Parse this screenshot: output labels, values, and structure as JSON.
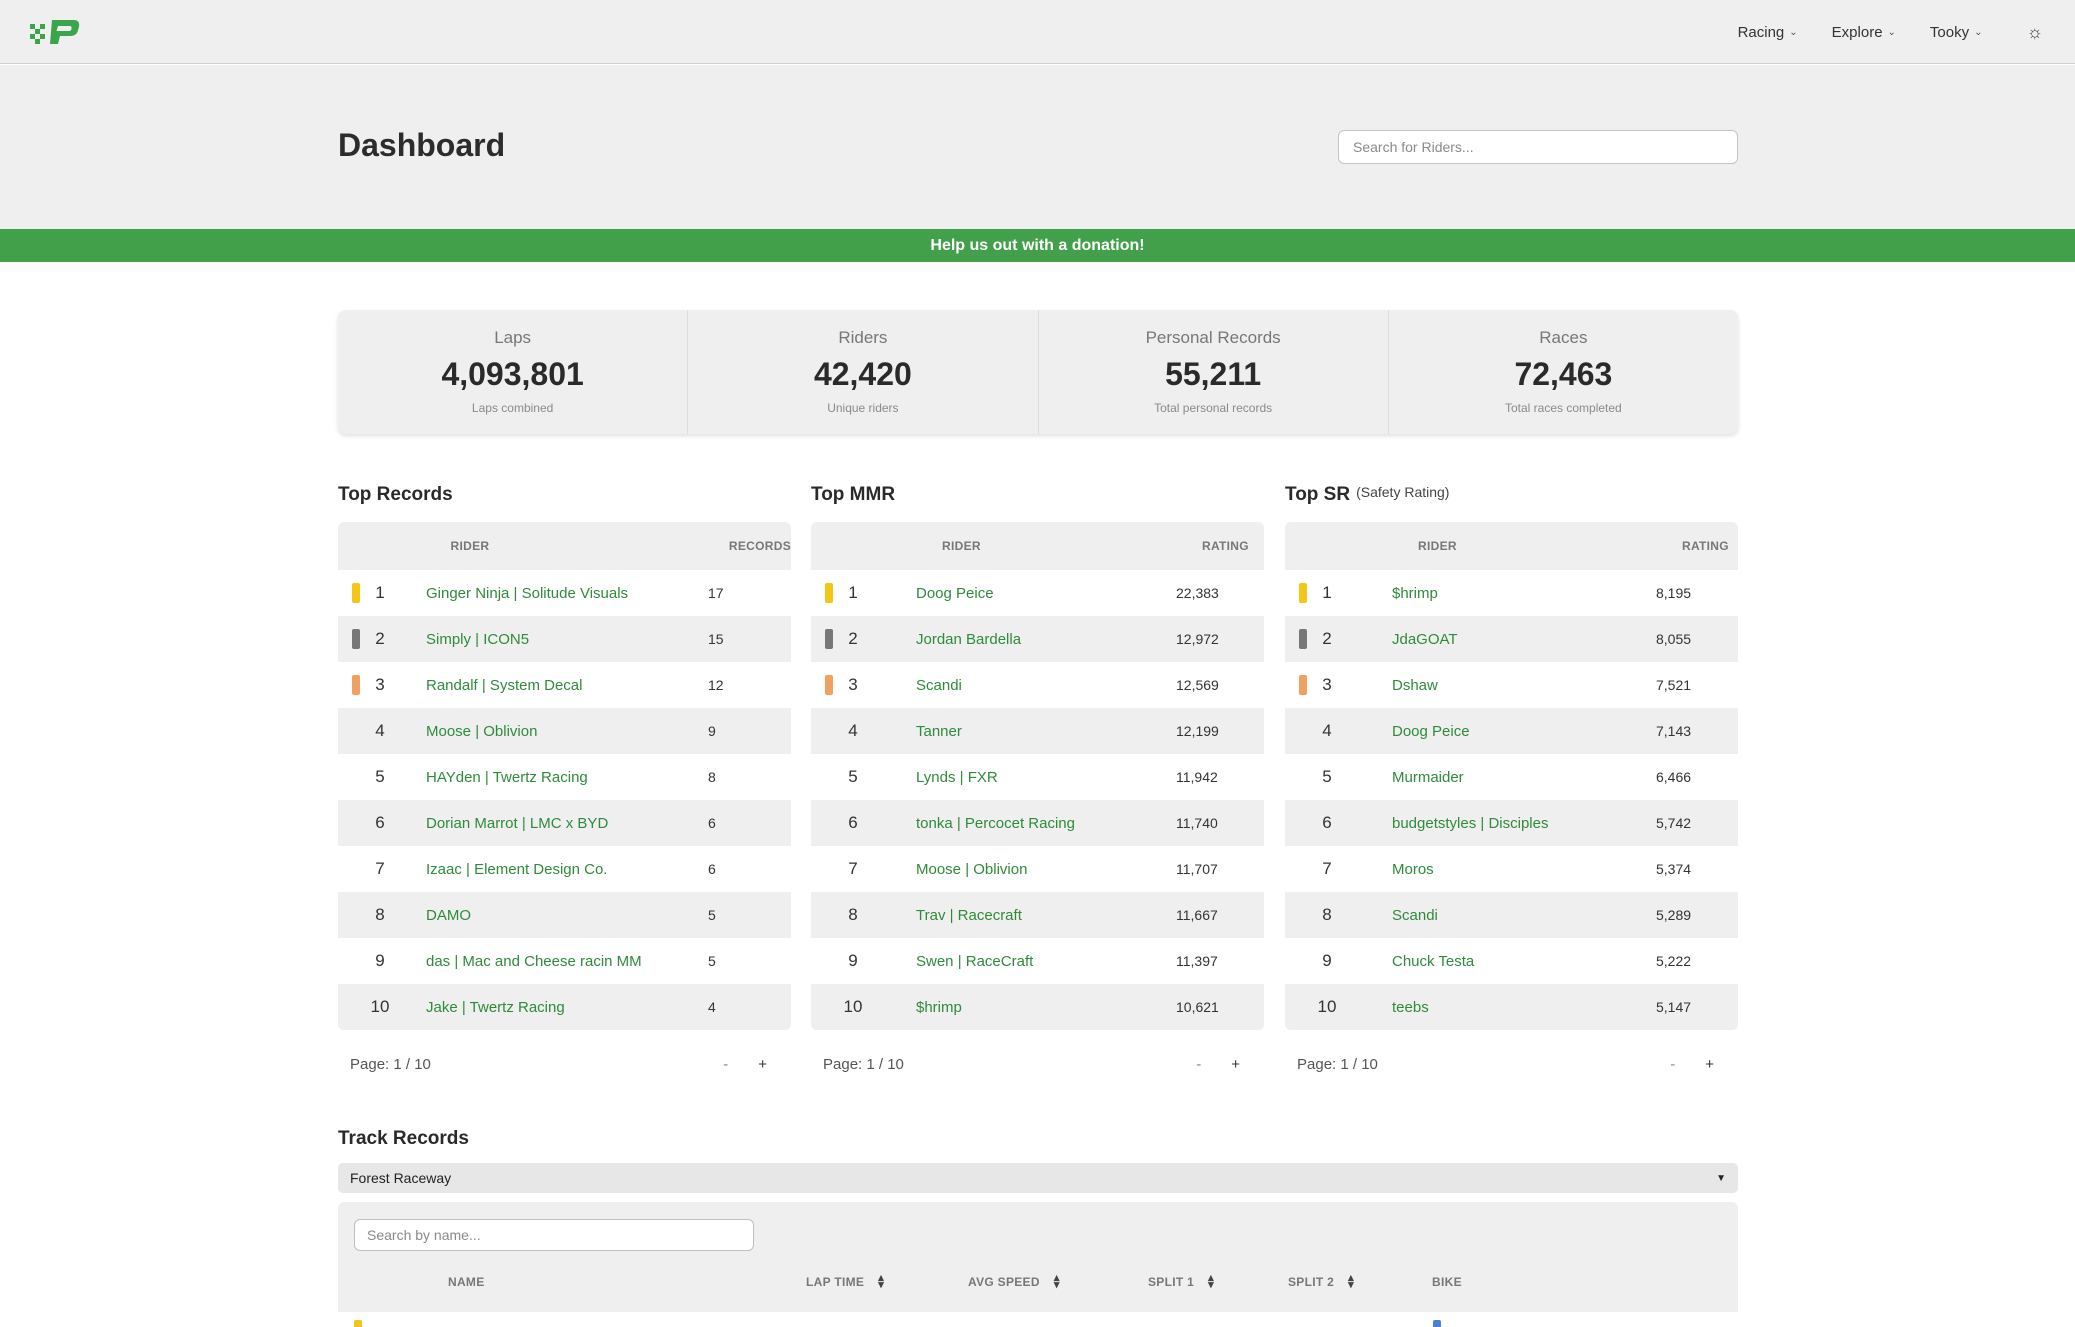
{
  "nav": {
    "items": [
      {
        "label": "Racing"
      },
      {
        "label": "Explore"
      },
      {
        "label": "Tooky"
      }
    ]
  },
  "header": {
    "title": "Dashboard",
    "search_placeholder": "Search for Riders..."
  },
  "donation": {
    "text": "Help us out with a donation!"
  },
  "stats": [
    {
      "label": "Laps",
      "value": "4,093,801",
      "desc": "Laps combined"
    },
    {
      "label": "Riders",
      "value": "42,420",
      "desc": "Unique riders"
    },
    {
      "label": "Personal Records",
      "value": "55,211",
      "desc": "Total personal records"
    },
    {
      "label": "Races",
      "value": "72,463",
      "desc": "Total races completed"
    }
  ],
  "medal_colors": {
    "gold": "#f5c518",
    "silver": "#777777",
    "bronze": "#f0a060"
  },
  "boards": [
    {
      "title": "Top Records",
      "subtitle": "",
      "col_rider": "RIDER",
      "col_value": "RECORDS",
      "page": "Page: 1 / 10",
      "rows": [
        {
          "rank": "1",
          "rider": "Ginger Ninja | Solitude Visuals",
          "value": "17"
        },
        {
          "rank": "2",
          "rider": "Simply | ICON5",
          "value": "15"
        },
        {
          "rank": "3",
          "rider": "Randalf | System Decal",
          "value": "12"
        },
        {
          "rank": "4",
          "rider": "Moose | Oblivion",
          "value": "9"
        },
        {
          "rank": "5",
          "rider": "HAYden | Twertz Racing",
          "value": "8"
        },
        {
          "rank": "6",
          "rider": "Dorian Marrot | LMC x BYD",
          "value": "6"
        },
        {
          "rank": "7",
          "rider": "Izaac | Element Design Co.",
          "value": "6"
        },
        {
          "rank": "8",
          "rider": "DAMO",
          "value": "5"
        },
        {
          "rank": "9",
          "rider": "das | Mac and Cheese racin MM",
          "value": "5"
        },
        {
          "rank": "10",
          "rider": "Jake | Twertz Racing",
          "value": "4"
        }
      ]
    },
    {
      "title": "Top MMR",
      "subtitle": "",
      "col_rider": "RIDER",
      "col_value": "RATING",
      "page": "Page: 1 / 10",
      "rows": [
        {
          "rank": "1",
          "rider": "Doog Peice",
          "value": "22,383"
        },
        {
          "rank": "2",
          "rider": "Jordan Bardella",
          "value": "12,972"
        },
        {
          "rank": "3",
          "rider": "Scandi",
          "value": "12,569"
        },
        {
          "rank": "4",
          "rider": "Tanner",
          "value": "12,199"
        },
        {
          "rank": "5",
          "rider": "Lynds | FXR",
          "value": "11,942"
        },
        {
          "rank": "6",
          "rider": "tonka | Percocet Racing",
          "value": "11,740"
        },
        {
          "rank": "7",
          "rider": "Moose | Oblivion",
          "value": "11,707"
        },
        {
          "rank": "8",
          "rider": "Trav | Racecraft",
          "value": "11,667"
        },
        {
          "rank": "9",
          "rider": "Swen | RaceCraft",
          "value": "11,397"
        },
        {
          "rank": "10",
          "rider": "$hrimp",
          "value": "10,621"
        }
      ]
    },
    {
      "title": "Top SR",
      "subtitle": "(Safety Rating)",
      "col_rider": "RIDER",
      "col_value": "RATING",
      "page": "Page: 1 / 10",
      "rows": [
        {
          "rank": "1",
          "rider": "$hrimp",
          "value": "8,195"
        },
        {
          "rank": "2",
          "rider": "JdaGOAT",
          "value": "8,055"
        },
        {
          "rank": "3",
          "rider": "Dshaw",
          "value": "7,521"
        },
        {
          "rank": "4",
          "rider": "Doog Peice",
          "value": "7,143"
        },
        {
          "rank": "5",
          "rider": "Murmaider",
          "value": "6,466"
        },
        {
          "rank": "6",
          "rider": "budgetstyles | Disciples",
          "value": "5,742"
        },
        {
          "rank": "7",
          "rider": "Moros",
          "value": "5,374"
        },
        {
          "rank": "8",
          "rider": "Scandi",
          "value": "5,289"
        },
        {
          "rank": "9",
          "rider": "Chuck Testa",
          "value": "5,222"
        },
        {
          "rank": "10",
          "rider": "teebs",
          "value": "5,147"
        }
      ]
    }
  ],
  "pager": {
    "minus": "-",
    "plus": "+"
  },
  "track": {
    "title": "Track Records",
    "selected": "Forest Raceway",
    "search_placeholder": "Search by name...",
    "columns": [
      "NAME",
      "LAP TIME",
      "AVG SPEED",
      "SPLIT 1",
      "SPLIT 2",
      "BIKE"
    ]
  }
}
